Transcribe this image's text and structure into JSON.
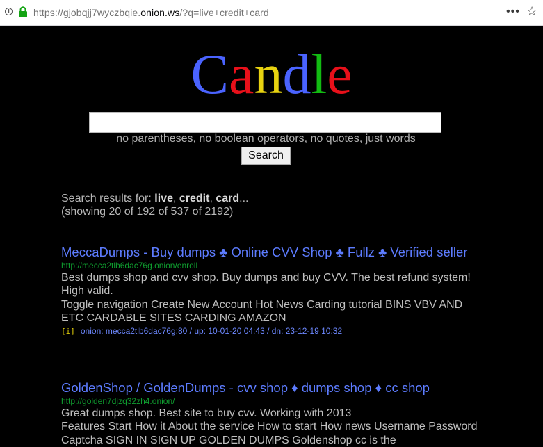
{
  "browser": {
    "url_prefix": "https://gjobqjj7wyczbqie.",
    "url_domain": "onion.ws",
    "url_suffix": "/?q=live+credit+card"
  },
  "logo": {
    "letters": [
      {
        "char": "C",
        "color": "#4a63ff"
      },
      {
        "char": "a",
        "color": "#e8101a"
      },
      {
        "char": "n",
        "color": "#e8d210"
      },
      {
        "char": "d",
        "color": "#4a63ff"
      },
      {
        "char": "l",
        "color": "#12bb12"
      },
      {
        "char": "e",
        "color": "#e8101a"
      }
    ]
  },
  "search": {
    "query": "",
    "hint": "no parentheses, no boolean operators, no quotes, just words",
    "button": "Search"
  },
  "summary": {
    "prefix": "Search results for: ",
    "terms": [
      "live",
      "credit",
      "card"
    ],
    "ellipsis": "...",
    "showing": "(showing 20 of 192 of 537 of 2192)"
  },
  "results": [
    {
      "title": "MeccaDumps - Buy dumps ♣ Online CVV Shop ♣ Fullz ♣ Verified seller",
      "url": "http://mecca2tlb6dac76g.onion/enroll",
      "desc": "Best dumps shop and cvv shop. Buy dumps and buy CVV. The best refund system! High valid.",
      "desc2": "Toggle navigation Create New Account Hot News Carding tutorial BINS VBV AND ETC CARDABLE SITES CARDING AMAZON",
      "tag": "[i]",
      "meta": "onion: mecca2tlb6dac76g:80 / up: 10-01-20 04:43 / dn: 23-12-19 10:32"
    },
    {
      "title": "GoldenShop / GoldenDumps - cvv shop ♦ dumps shop ♦ cc shop",
      "url": "http://golden7djzq32zh4.onion/",
      "desc": "Great dumps shop. Best site to buy cvv. Working with 2013",
      "desc2": "Features Start How it About the service How to start How news Username Password Captcha SIGN IN SIGN UP GOLDEN DUMPS Goldenshop cc is the"
    }
  ]
}
